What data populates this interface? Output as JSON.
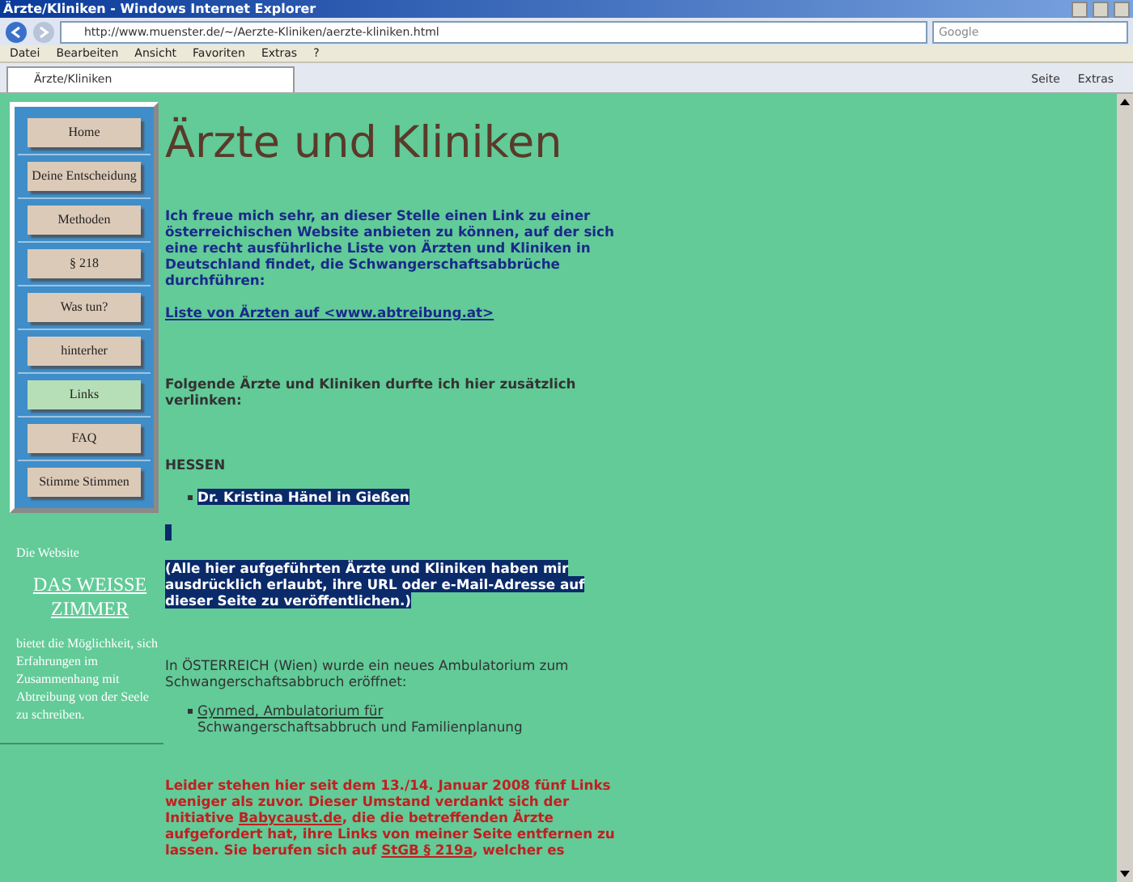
{
  "window": {
    "title": "Ärzte/Kliniken - Windows Internet Explorer"
  },
  "address_bar": {
    "url": "http://www.muenster.de/~/Aerzte-Kliniken/aerzte-kliniken.html",
    "search_placeholder": "Google"
  },
  "menu": [
    "Datei",
    "Bearbeiten",
    "Ansicht",
    "Favoriten",
    "Extras",
    "?"
  ],
  "tabs": [
    {
      "label": "Ärzte/Kliniken",
      "selected": true
    }
  ],
  "toolbar": [
    "Seite",
    "Extras"
  ],
  "sidebar": {
    "items": [
      {
        "label": "Home",
        "selected": false
      },
      {
        "label": "Deine Entscheidung",
        "selected": false
      },
      {
        "label": "Methoden",
        "selected": false
      },
      {
        "label": "§ 218",
        "selected": false
      },
      {
        "label": "Was tun?",
        "selected": false
      },
      {
        "label": "hinterher",
        "selected": false
      },
      {
        "label": "Links",
        "selected": true
      },
      {
        "label": "FAQ",
        "selected": false
      },
      {
        "label": "Stimme Stimmen",
        "selected": false
      }
    ],
    "intro": "Die Website",
    "site_link": "DAS WEISSE ZIMMER",
    "description": "bietet die Möglichkeit, sich Erfahrungen im Zusammenhang mit Abtreibung von der Seele zu schreiben."
  },
  "content": {
    "heading": "Ärzte und Kliniken",
    "intro": "Ich freue mich sehr, an dieser Stelle einen Link zu einer österreichischen Website anbieten zu können, auf der sich eine recht ausführliche Liste von Ärzten und Kliniken in Deutschland findet, die Schwangerschaftsabbrüche durchführen:",
    "list_link": "Liste von Ärzten auf <www.abtreibung.at>",
    "additional": "Folgende Ärzte und Kliniken durfte ich hier zusätzlich verlinken:",
    "region": "HESSEN",
    "doctors": [
      "Dr. Kristina Hänel in Gießen"
    ],
    "permission_note": "(Alle hier aufgeführten Ärzte und Kliniken haben mir ausdrücklich erlaubt, ihre URL oder e-Mail-Adresse auf dieser Seite zu veröffentlichen.)",
    "austria": "In ÖSTERREICH (Wien) wurde ein neues Ambulatorium zum Schwangerschaftsabbruch eröffnet:",
    "austria_link": "Gynmed, Ambulatorium für",
    "austria_link_rest": "Schwangerschaftsabbruch und Familienplanung",
    "notice": [
      {
        "kind": "text",
        "text": "Leider stehen hier seit dem 13./14. Januar 2008 fünf Links weniger als zuvor. Dieser Umstand verdankt sich der Initiative "
      },
      {
        "kind": "link",
        "text": "Babycaust.de"
      },
      {
        "kind": "text",
        "text": ", die die betreffenden Ärzte aufgefordert hat, ihre Links von meiner Seite entfernen zu lassen. Sie berufen sich auf "
      },
      {
        "kind": "link",
        "text": "StGB § 219a"
      },
      {
        "kind": "text",
        "text": ", welcher es"
      }
    ]
  }
}
